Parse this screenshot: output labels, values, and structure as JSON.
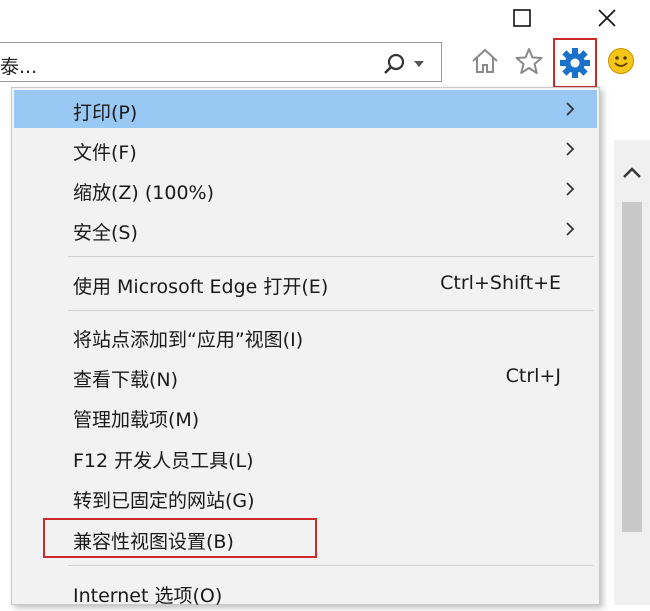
{
  "address_bar": {
    "text": "泰..."
  },
  "menu": {
    "items": [
      {
        "label": "打印(P)",
        "submenu": true,
        "highlighted": true
      },
      {
        "label": "文件(F)",
        "submenu": true
      },
      {
        "label": "缩放(Z) (100%)",
        "submenu": true
      },
      {
        "label": "安全(S)",
        "submenu": true
      },
      {
        "label": "使用 Microsoft Edge 打开(E)",
        "shortcut": "Ctrl+Shift+E"
      },
      {
        "label": "将站点添加到“应用”视图(I)"
      },
      {
        "label": "查看下载(N)",
        "shortcut": "Ctrl+J"
      },
      {
        "label": "管理加载项(M)"
      },
      {
        "label": "F12 开发人员工具(L)"
      },
      {
        "label": "转到已固定的网站(G)"
      },
      {
        "label": "兼容性视图设置(B)",
        "outlined": true
      },
      {
        "label": "Internet 选项(O)"
      }
    ]
  },
  "colors": {
    "highlight": "#99c8f4",
    "outline": "#cc2a2a",
    "gear": "#1a73c9",
    "smiley": "#f5c518"
  },
  "icons": [
    "maximize-icon",
    "close-icon",
    "search-icon",
    "home-icon",
    "favorites-star-icon",
    "gear-icon",
    "smiley-icon"
  ]
}
